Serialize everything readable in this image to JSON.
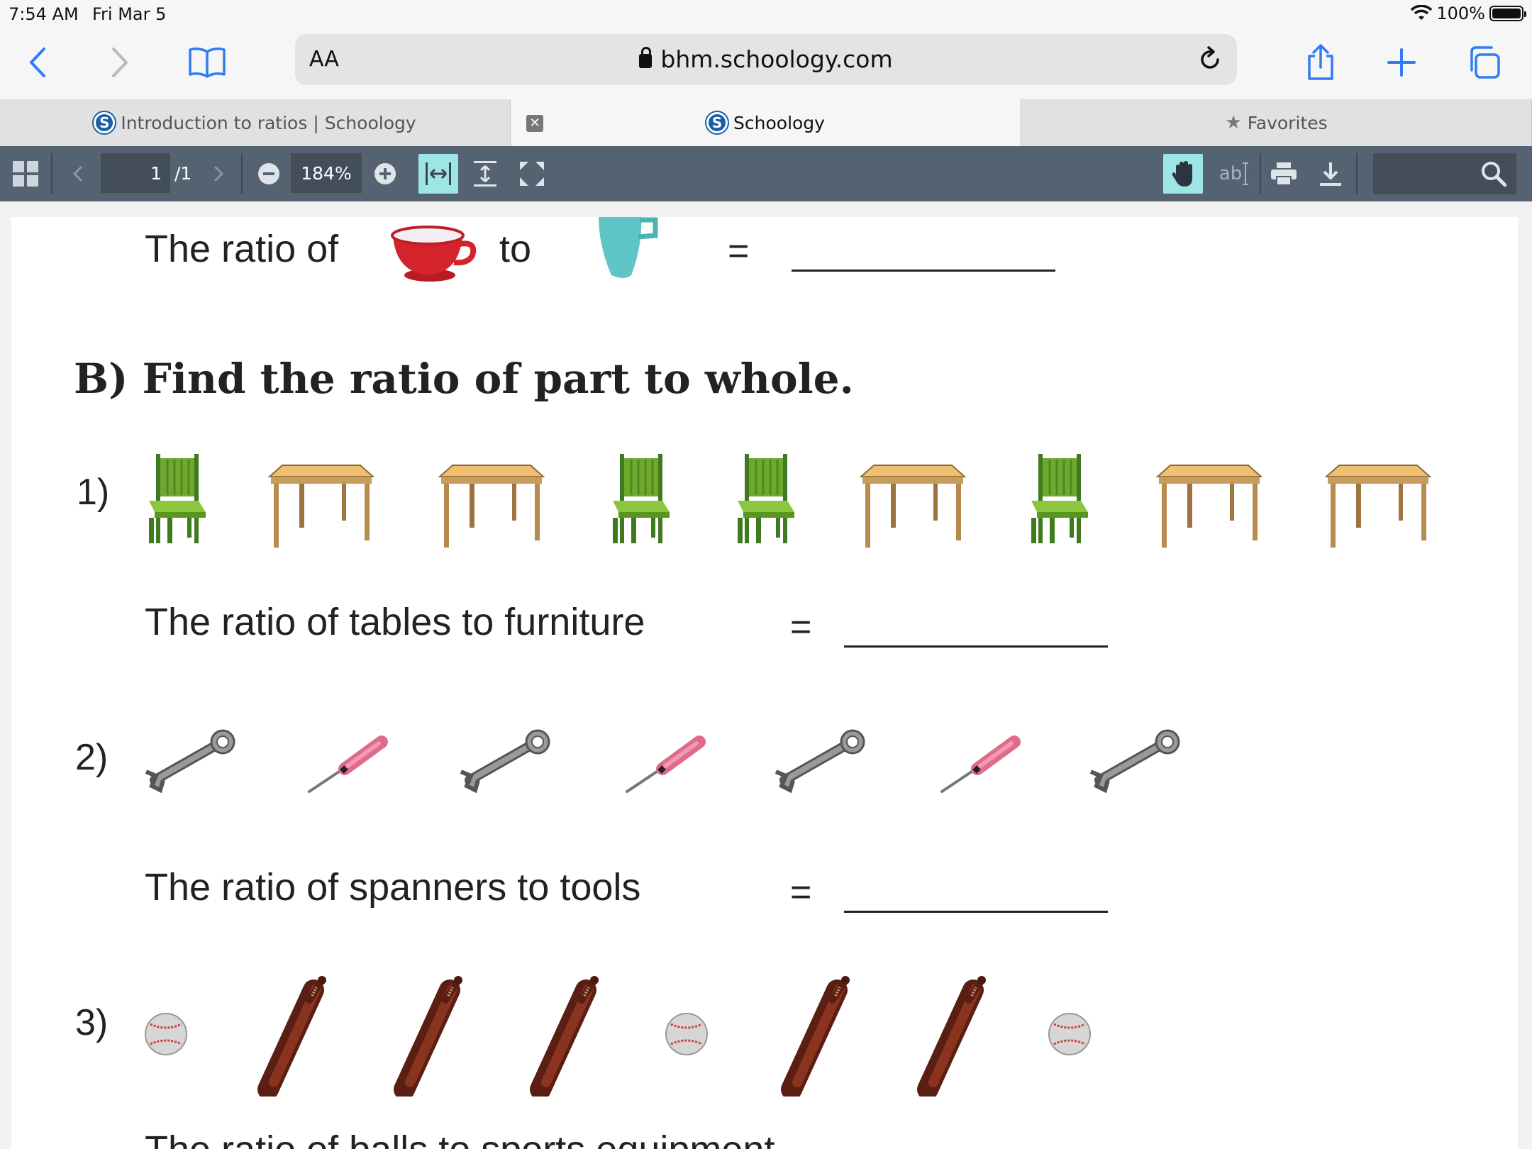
{
  "status": {
    "time": "7:54 AM",
    "date": "Fri Mar 5",
    "battery": "100%"
  },
  "browser": {
    "aa_label": "AA",
    "url": "bhm.schoology.com",
    "tabs": [
      {
        "label": "Introduction to ratios | Schoology",
        "favicon": "S"
      },
      {
        "label": "Schoology",
        "favicon": "S"
      },
      {
        "label": "Favorites"
      }
    ]
  },
  "pdf_toolbar": {
    "page": "1",
    "page_total": "/1",
    "zoom": "184%",
    "text_tool": "ab"
  },
  "worksheet": {
    "top_row": {
      "label": "The ratio of",
      "connector": "to",
      "equals": "="
    },
    "section_b": "B)  Find the ratio of  part to whole.",
    "q1": {
      "number": "1)",
      "text": "The ratio of tables to furniture",
      "equals": "=",
      "items": [
        "chair",
        "table",
        "table",
        "chair",
        "chair",
        "table",
        "chair",
        "table",
        "table"
      ]
    },
    "q2": {
      "number": "2)",
      "text": "The ratio of spanners to tools",
      "equals": "=",
      "items": [
        "spanner",
        "screwdriver",
        "spanner",
        "screwdriver",
        "spanner",
        "screwdriver",
        "spanner"
      ]
    },
    "q3": {
      "number": "3)",
      "text": "The ratio of balls to sports equipment",
      "items": [
        "ball",
        "bat",
        "bat",
        "bat",
        "ball",
        "bat",
        "bat",
        "ball"
      ]
    }
  }
}
